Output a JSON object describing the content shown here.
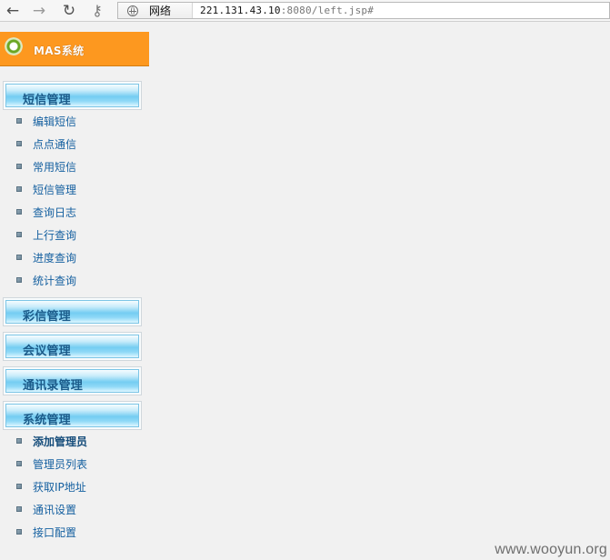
{
  "browser": {
    "security_label": "网络",
    "url_host": "221.131.43.10",
    "url_rest": ":8080/left.jsp#",
    "icons": {
      "back": "back-arrow-icon",
      "forward": "forward-arrow-icon",
      "reload": "reload-icon",
      "key": "key-icon",
      "globe": "globe-icon"
    }
  },
  "sidebar": {
    "system_title": "MAS系统",
    "sections": [
      {
        "label": "短信管理",
        "items": [
          "编辑短信",
          "点点通信",
          "常用短信",
          "短信管理",
          "查询日志",
          "上行查询",
          "进度查询",
          "统计查询"
        ]
      },
      {
        "label": "彩信管理",
        "items": []
      },
      {
        "label": "会议管理",
        "items": []
      },
      {
        "label": "通讯录管理",
        "items": []
      },
      {
        "label": "系统管理",
        "items": [
          "添加管理员",
          "管理员列表",
          "获取IP地址",
          "通讯设置",
          "接口配置"
        ]
      }
    ]
  },
  "watermark": "www.wooyun.org",
  "colors": {
    "system_header": "#fd981f",
    "section_text": "#1b5b8a",
    "item_text": "#1560a0",
    "background": "#f1f1f1"
  }
}
